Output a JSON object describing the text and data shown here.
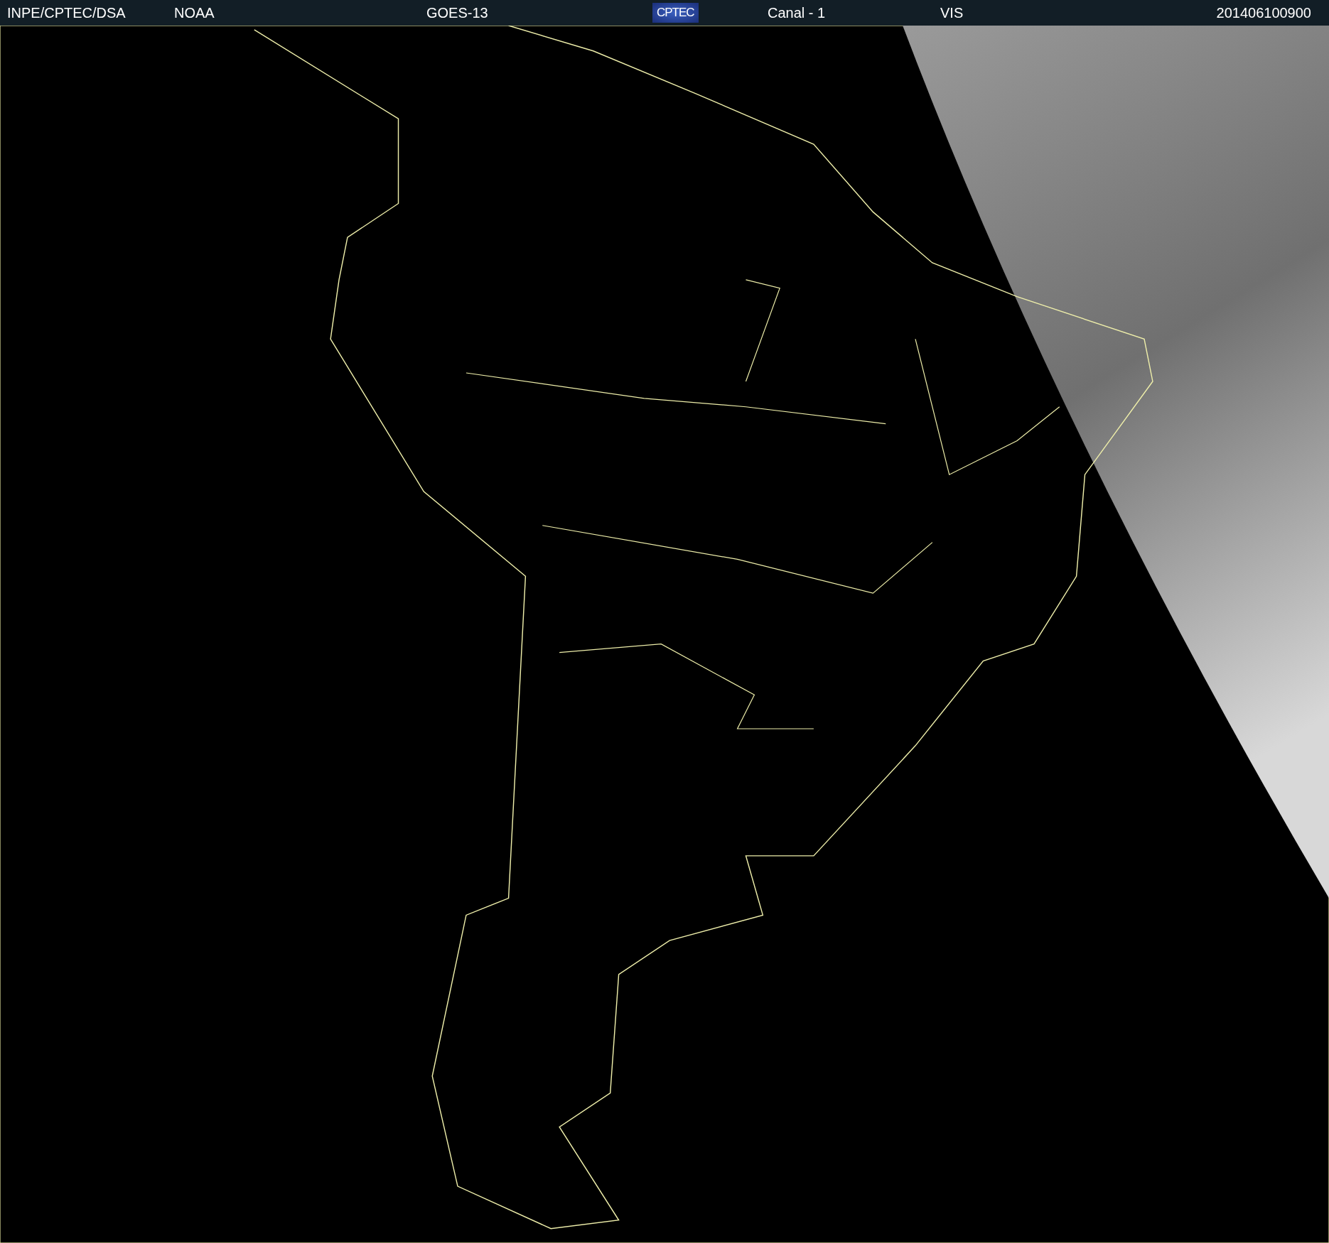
{
  "header": {
    "source": "INPE/CPTEC/DSA",
    "agency": "NOAA",
    "satellite": "GOES-13",
    "logo": "CPTEC",
    "channel": "Canal - 1",
    "band": "VIS",
    "timestamp": "201406100900"
  }
}
